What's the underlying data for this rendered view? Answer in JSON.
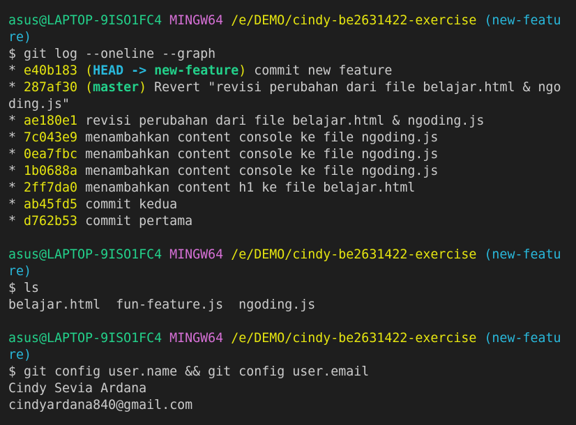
{
  "prompt": {
    "user": "asus@LAPTOP-9ISO1FC4",
    "system": "MINGW64",
    "path": "/e/DEMO/cindy-be2631422-exercise",
    "branch_part1": "(new-featu",
    "branch_part2": "re)"
  },
  "commands": {
    "log": "$ git log --oneline --graph",
    "ls": "$ ls",
    "config": "$ git config user.name && git config user.email"
  },
  "log_entries": [
    {
      "bullet": "* ",
      "hash": "e40b183",
      "head": "HEAD",
      "arrow": " -> ",
      "branch": "new-feature",
      "message": " commit new feature"
    },
    {
      "bullet": "* ",
      "hash": "287af30",
      "branch": "master",
      "message_line1": " Revert \"revisi perubahan dari file belajar.html & ngo",
      "message_line2": "ding.js\""
    },
    {
      "bullet": "* ",
      "hash": "ae180e1",
      "message": " revisi perubahan dari file belajar.html & ngoding.js"
    },
    {
      "bullet": "* ",
      "hash": "7c043e9",
      "message": " menambahkan content console ke file ngoding.js"
    },
    {
      "bullet": "* ",
      "hash": "0ea7fbc",
      "message": " menambahkan content console ke file ngoding.js"
    },
    {
      "bullet": "* ",
      "hash": "1b0688a",
      "message": " menambahkan content console ke file ngoding.js"
    },
    {
      "bullet": "* ",
      "hash": "2ff7da0",
      "message": " menambahkan content h1 ke file belajar.html"
    },
    {
      "bullet": "* ",
      "hash": "ab45fd5",
      "message": " commit kedua"
    },
    {
      "bullet": "* ",
      "hash": "d762b53",
      "message": " commit pertama"
    }
  ],
  "ls_output": "belajar.html  fun-feature.js  ngoding.js",
  "config_output": {
    "name": "Cindy Sevia Ardana",
    "email": "cindyardana840@gmail.com"
  },
  "colors": {
    "background": "#1e1e1e",
    "text": "#cccccc",
    "user_green": "#23d18b",
    "mingw_magenta": "#d670d6",
    "path_yellow": "#e5e510",
    "branch_cyan": "#29b8db"
  }
}
